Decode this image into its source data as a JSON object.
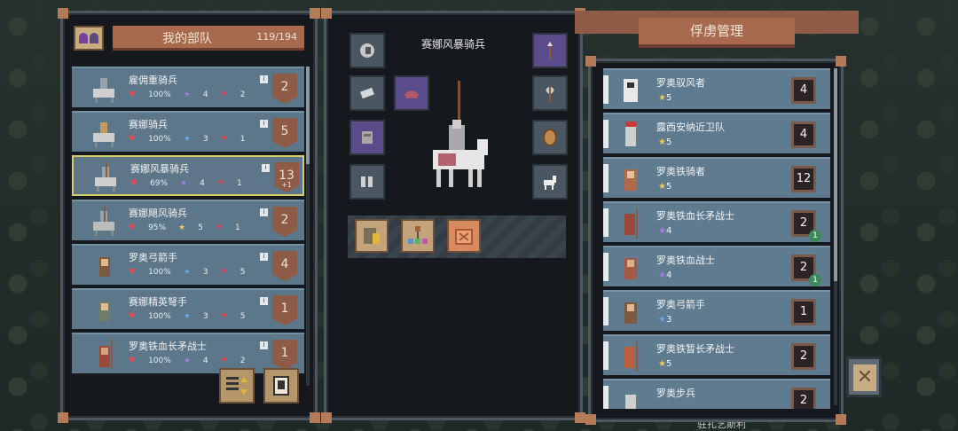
{
  "army_panel": {
    "title": "我的部队",
    "count": "119/194",
    "units": [
      {
        "name": "雇佣重骑兵",
        "hp": "100%",
        "level": "4",
        "star_color": "purple",
        "flags": "2",
        "count": "2",
        "plus": ""
      },
      {
        "name": "赛娜骑兵",
        "hp": "100%",
        "level": "3",
        "star_color": "blue",
        "flags": "1",
        "count": "5",
        "plus": ""
      },
      {
        "name": "赛娜风暴骑兵",
        "hp": "69%",
        "level": "4",
        "star_color": "purple",
        "flags": "1",
        "count": "13",
        "plus": "+1",
        "selected": true
      },
      {
        "name": "赛娜飓风骑兵",
        "hp": "95%",
        "level": "5",
        "star_color": "gold",
        "flags": "1",
        "count": "2",
        "plus": ""
      },
      {
        "name": "罗奥弓箭手",
        "hp": "100%",
        "level": "3",
        "star_color": "blue",
        "flags": "5",
        "count": "4",
        "plus": ""
      },
      {
        "name": "赛娜精英弩手",
        "hp": "100%",
        "level": "3",
        "star_color": "blue",
        "flags": "5",
        "count": "1",
        "plus": ""
      },
      {
        "name": "罗奥铁血长矛战士",
        "hp": "100%",
        "level": "4",
        "star_color": "purple",
        "flags": "2",
        "count": "1",
        "plus": ""
      }
    ]
  },
  "unit_detail": {
    "title": "赛娜风暴骑兵"
  },
  "prisoner_panel": {
    "title": "俘虏管理",
    "prisoners": [
      {
        "name": "罗奥驭风者",
        "stars": "5",
        "star_color": "gold",
        "count": "4",
        "extra": ""
      },
      {
        "name": "露西安纳近卫队",
        "stars": "5",
        "star_color": "gold",
        "count": "4",
        "extra": ""
      },
      {
        "name": "罗奥铁骑者",
        "stars": "5",
        "star_color": "gold",
        "count": "12",
        "extra": ""
      },
      {
        "name": "罗奥铁血长矛战士",
        "stars": "4",
        "star_color": "purple",
        "count": "2",
        "extra": "1"
      },
      {
        "name": "罗奥铁血战士",
        "stars": "4",
        "star_color": "purple",
        "count": "2",
        "extra": "1"
      },
      {
        "name": "罗奥弓箭手",
        "stars": "3",
        "star_color": "blue",
        "count": "1",
        "extra": ""
      },
      {
        "name": "罗奥铁暂长矛战士",
        "stars": "5",
        "star_color": "gold",
        "count": "2",
        "extra": ""
      },
      {
        "name": "罗奥步兵",
        "stars": "",
        "star_color": "gold",
        "count": "2",
        "extra": ""
      }
    ]
  },
  "background_label": "驻扎艺斯利"
}
